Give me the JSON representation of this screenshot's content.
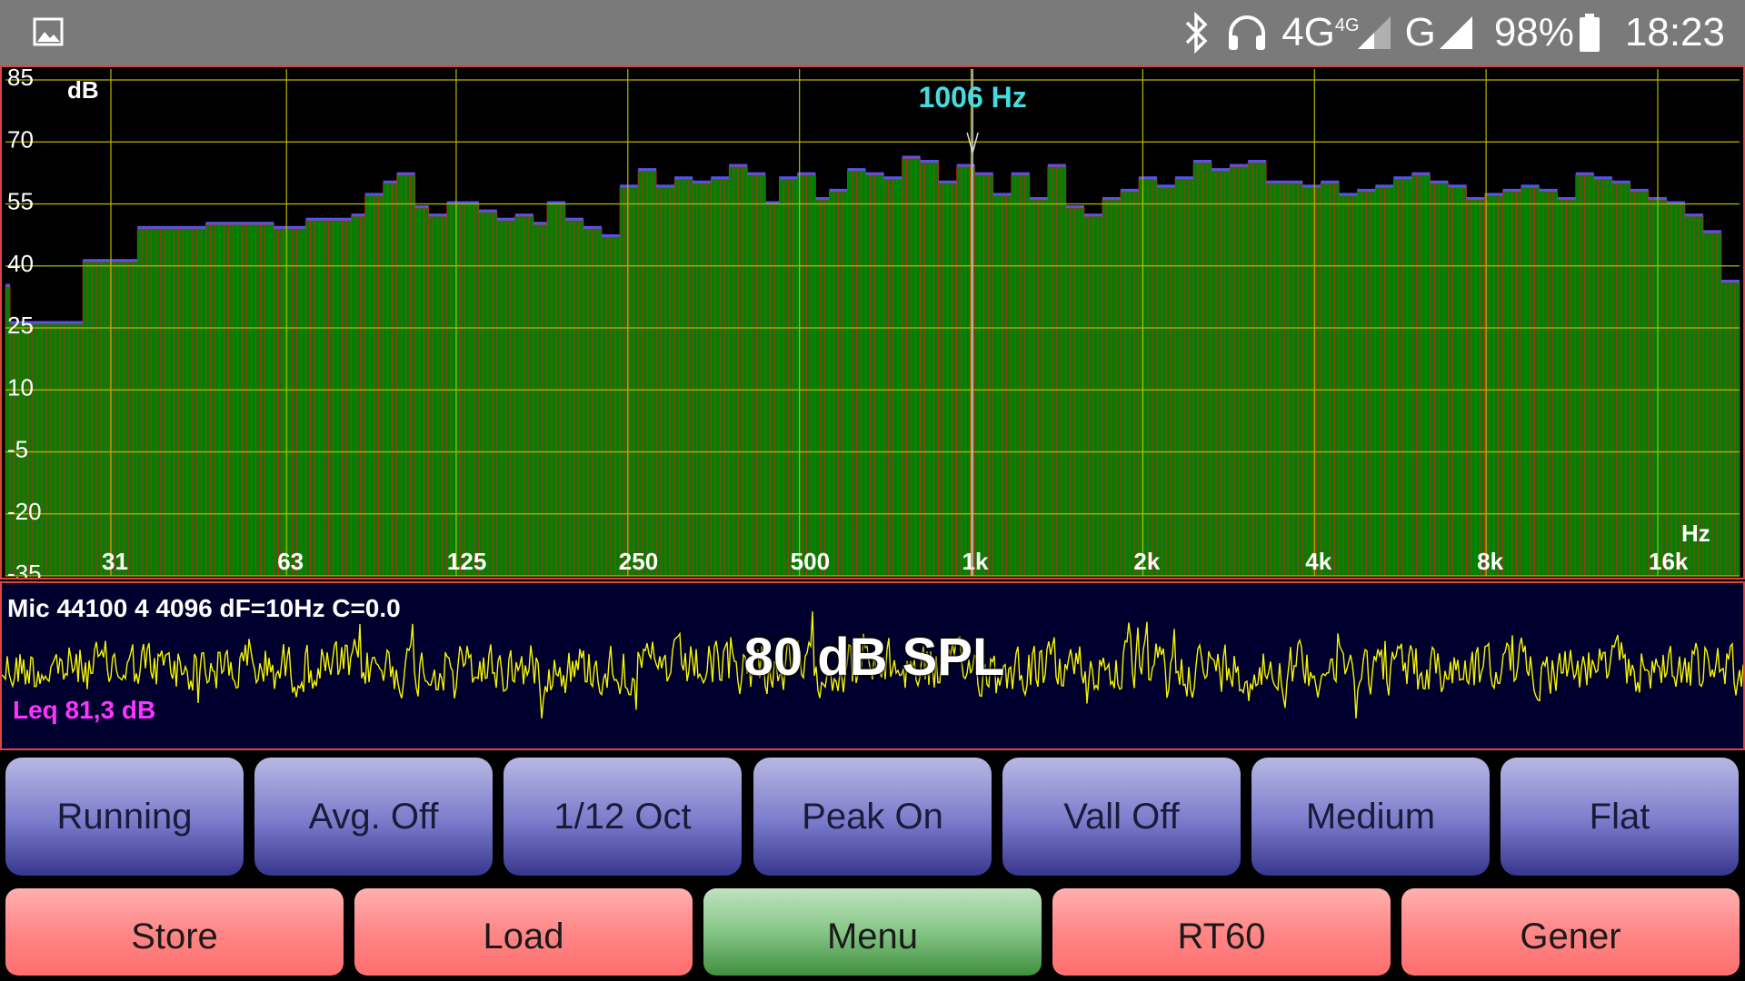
{
  "status_bar": {
    "icons": [
      "image-icon",
      "bluetooth-icon",
      "headset-icon",
      "signal-4g-icon",
      "signal-g-icon",
      "battery-icon"
    ],
    "network_primary": "4G",
    "network_primary_sup": "4G",
    "network_secondary": "G",
    "battery": "98%",
    "time": "18:23"
  },
  "spectrum": {
    "unit": "dB",
    "freq_unit": "Hz",
    "y_labels": [
      "85",
      "70",
      "55",
      "40",
      "25",
      "10",
      "-5",
      "-20",
      "-35"
    ],
    "x_labels": [
      "31",
      "63",
      "125",
      "250",
      "500",
      "1k",
      "2k",
      "4k",
      "8k",
      "16k"
    ],
    "marker_label": "1006 Hz",
    "colors": {
      "bar": "#008000",
      "bar_edge": "#cc2222",
      "peak": "#5555ee",
      "grid": "#b8b800",
      "marker": "#44dddd"
    },
    "chart_data": {
      "type": "bar",
      "ylim": [
        -35,
        85
      ],
      "x_scale": "log",
      "x_ticks_hz": [
        31,
        63,
        125,
        250,
        500,
        1000,
        2000,
        4000,
        8000,
        16000
      ],
      "y_ticks_db": [
        85,
        70,
        55,
        40,
        25,
        10,
        -5,
        -20,
        -35
      ],
      "marker_hz": 1006,
      "bands_db": [
        35,
        26,
        26,
        26,
        26,
        26,
        26,
        26,
        26,
        26,
        26,
        26,
        26,
        26,
        26,
        26,
        26,
        41,
        41,
        41,
        41,
        41,
        41,
        41,
        41,
        41,
        41,
        41,
        41,
        49,
        49,
        49,
        49,
        49,
        49,
        49,
        49,
        49,
        49,
        49,
        49,
        49,
        49,
        49,
        50,
        50,
        50,
        50,
        50,
        50,
        50,
        50,
        50,
        50,
        50,
        50,
        50,
        50,
        50,
        49,
        49,
        49,
        49,
        49,
        49,
        49,
        51,
        51,
        51,
        51,
        51,
        51,
        51,
        51,
        51,
        51,
        52,
        52,
        52,
        57,
        57,
        57,
        57,
        60,
        60,
        60,
        62,
        62,
        62,
        62,
        54,
        54,
        54,
        52,
        52,
        52,
        52,
        55,
        55,
        55,
        55,
        55,
        55,
        55,
        53,
        53,
        53,
        53,
        51,
        51,
        51,
        51,
        52,
        52,
        52,
        52,
        50,
        50,
        50,
        55,
        55,
        55,
        55,
        51,
        51,
        51,
        51,
        49,
        49,
        49,
        49,
        47,
        47,
        47,
        47,
        59,
        59,
        59,
        59,
        63,
        63,
        63,
        63,
        59,
        59,
        59,
        59,
        61,
        61,
        61,
        61,
        60,
        60,
        60,
        60,
        61,
        61,
        61,
        61,
        64,
        64,
        64,
        64,
        62,
        62,
        62,
        62,
        55,
        55,
        55,
        61,
        61,
        61,
        61,
        62,
        62,
        62,
        62,
        56,
        56,
        56,
        58,
        58,
        58,
        58,
        63,
        63,
        63,
        63,
        62,
        62,
        62,
        62,
        61,
        61,
        61,
        61,
        66,
        66,
        66,
        66,
        65,
        65,
        65,
        65,
        60,
        60,
        60,
        60,
        64,
        64,
        64,
        64,
        62,
        62,
        62,
        62,
        57,
        57,
        57,
        57,
        62,
        62,
        62,
        62,
        56,
        56,
        56,
        56,
        64,
        64,
        64,
        64,
        54,
        54,
        54,
        54,
        52,
        52,
        52,
        52,
        56,
        56,
        56,
        56,
        58,
        58,
        58,
        58,
        61,
        61,
        61,
        61,
        59,
        59,
        59,
        59,
        61,
        61,
        61,
        61,
        65,
        65,
        65,
        65,
        63,
        63,
        63,
        63,
        64,
        64,
        64,
        64,
        65,
        65,
        65,
        65,
        60,
        60,
        60,
        60,
        60,
        60,
        60,
        60,
        59,
        59,
        59,
        59,
        60,
        60,
        60,
        60,
        57,
        57,
        57,
        57,
        58,
        58,
        58,
        58,
        59,
        59,
        59,
        59,
        61,
        61,
        61,
        61,
        62,
        62,
        62,
        62,
        60,
        60,
        60,
        60,
        59,
        59,
        59,
        59,
        56,
        56,
        56,
        56,
        57,
        57,
        57,
        57,
        58,
        58,
        58,
        58,
        59,
        59,
        59,
        59,
        58,
        58,
        58,
        58,
        56,
        56,
        56,
        56,
        62,
        62,
        62,
        62,
        61,
        61,
        61,
        61,
        60,
        60,
        60,
        60,
        58,
        58,
        58,
        58,
        56,
        56,
        56,
        56,
        55,
        55,
        55,
        55,
        52,
        52,
        52,
        52,
        48,
        48,
        48,
        48,
        36,
        36,
        36,
        36
      ]
    }
  },
  "wave": {
    "info": "Mic 44100 4 4096 dF=10Hz C=0.0",
    "spl": "80 dB SPL",
    "leq": "Leq  81,3 dB",
    "color": "#f5f500"
  },
  "controls_row1": [
    {
      "label": "Running"
    },
    {
      "label": "Avg. Off"
    },
    {
      "label": "1/12 Oct"
    },
    {
      "label": "Peak On"
    },
    {
      "label": "Vall Off"
    },
    {
      "label": "Medium"
    },
    {
      "label": "Flat"
    }
  ],
  "controls_row2": [
    {
      "label": "Store"
    },
    {
      "label": "Load"
    },
    {
      "label": "Menu"
    },
    {
      "label": "RT60"
    },
    {
      "label": "Gener"
    }
  ]
}
